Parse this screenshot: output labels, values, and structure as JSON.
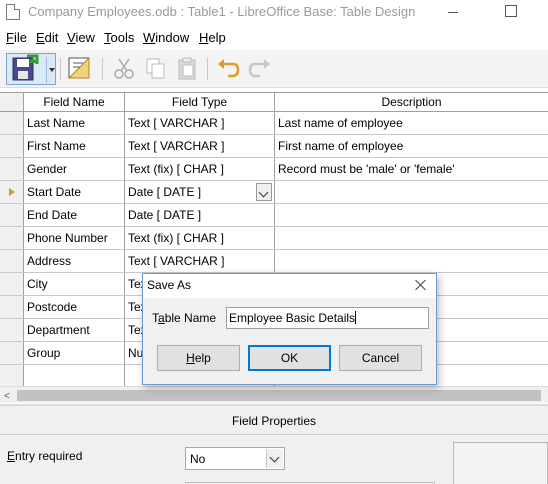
{
  "window": {
    "title": "Company Employees.odb : Table1 - LibreOffice Base: Table Design"
  },
  "menu": [
    {
      "mnemonic": "F",
      "rest": "ile"
    },
    {
      "mnemonic": "E",
      "rest": "dit"
    },
    {
      "mnemonic": "V",
      "rest": "iew"
    },
    {
      "mnemonic": "T",
      "rest": "ools"
    },
    {
      "mnemonic": "W",
      "rest": "indow"
    },
    {
      "mnemonic": "H",
      "rest": "elp"
    }
  ],
  "toolbar": {
    "icons": [
      "save-icon",
      "design-index-icon",
      "cut-icon",
      "copy-icon",
      "paste-icon",
      "undo-icon",
      "redo-icon"
    ]
  },
  "grid": {
    "headers": {
      "field_name": "Field Name",
      "field_type": "Field Type",
      "description": "Description"
    },
    "rows": [
      {
        "name": "Last Name",
        "type": "Text [ VARCHAR ]",
        "desc": "Last name of employee"
      },
      {
        "name": "First Name",
        "type": "Text [ VARCHAR ]",
        "desc": "First name of employee"
      },
      {
        "name": "Gender",
        "type": "Text (fix) [ CHAR ]",
        "desc": "Record must be 'male' or 'female'"
      },
      {
        "name": "Start Date",
        "type": "Date [ DATE ]",
        "desc": ""
      },
      {
        "name": "End Date",
        "type": "Date [ DATE ]",
        "desc": ""
      },
      {
        "name": "Phone Number",
        "type": "Text (fix) [ CHAR ]",
        "desc": ""
      },
      {
        "name": "Address",
        "type": "Text [ VARCHAR ]",
        "desc": ""
      },
      {
        "name": "City",
        "type": "Tex",
        "desc": ""
      },
      {
        "name": "Postcode",
        "type": "Tex",
        "desc": ""
      },
      {
        "name": "Department",
        "type": "Tex",
        "desc": ""
      },
      {
        "name": "Group",
        "type": "Nu",
        "desc": ""
      }
    ],
    "active_row": 3
  },
  "field_properties": {
    "title": "Field Properties",
    "entry_required_mnemonic": "E",
    "entry_required_rest": "ntry required",
    "entry_required_value": "No"
  },
  "dialog": {
    "title": "Save As",
    "label_prefix": "T",
    "label_mnemonic": "a",
    "label_rest": "ble Name",
    "value": "Employee Basic Details",
    "help_mnemonic": "H",
    "help_rest": "elp",
    "ok_label": "OK",
    "cancel_label": "Cancel"
  },
  "colors": {
    "accent": "#0078d7",
    "active_row_marker": "#c8a226",
    "save_icon_green": "#3a9a3a",
    "undo_orange": "#e09a2a"
  }
}
